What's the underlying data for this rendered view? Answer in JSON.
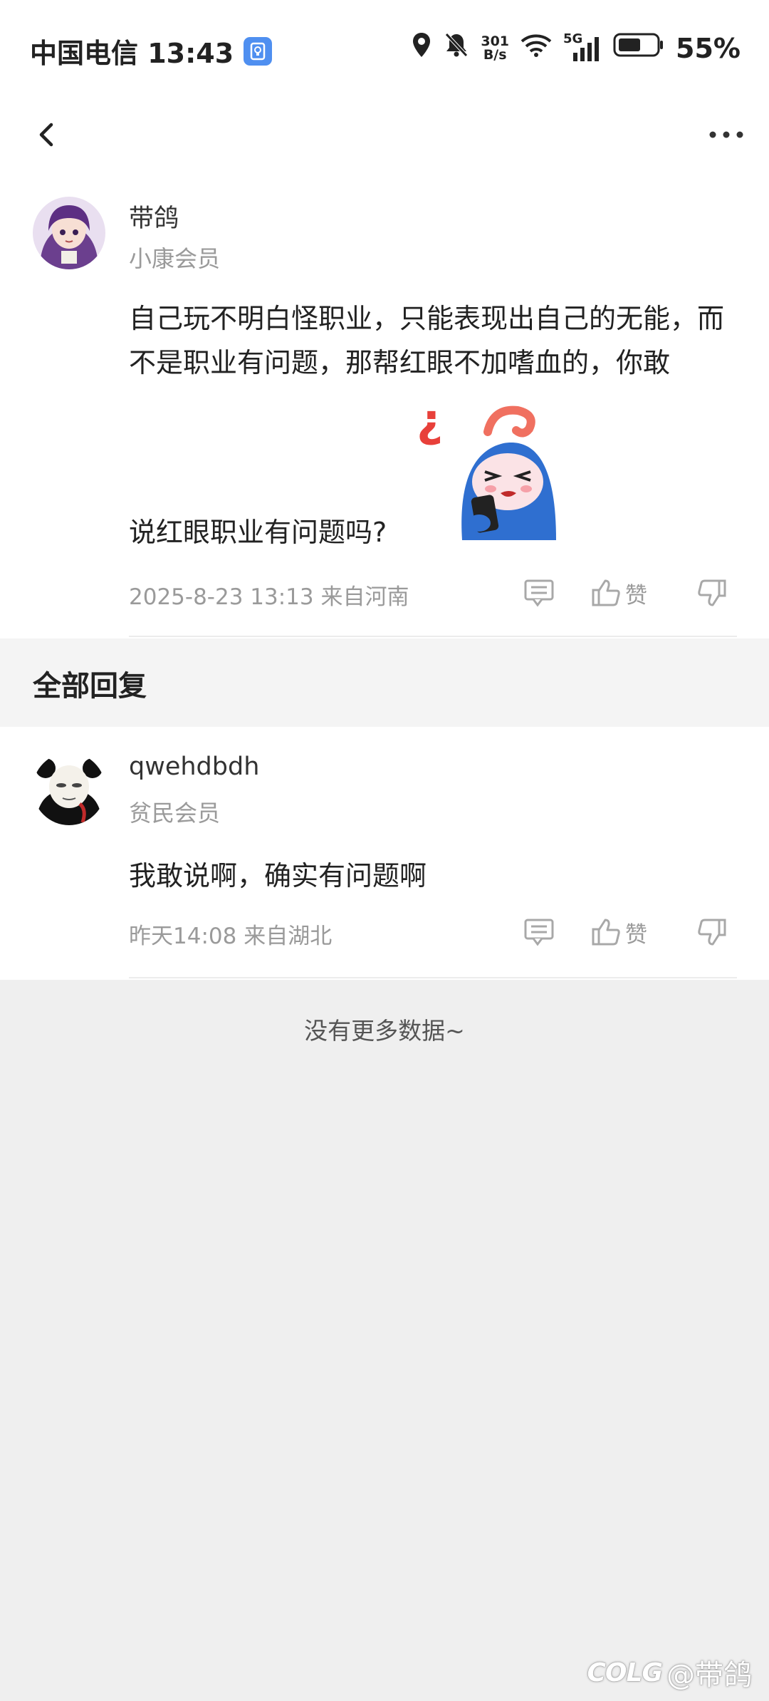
{
  "status_bar": {
    "carrier_time": "中国电信 13:43",
    "net_speed_top": "301",
    "net_speed_bottom": "B/s",
    "network": "5G",
    "battery": "55%"
  },
  "post": {
    "username": "带鸽",
    "level": "小康会员",
    "content": "自己玩不明白怪职业，只能表现出自己的无能，而不是职业有问题，那帮红眼不加嗜血的，你敢",
    "content_last": "说红眼职业有问题吗?",
    "time_location": "2025-8-23 13:13  来自河南",
    "like_label": "赞"
  },
  "section": {
    "title": "全部回复"
  },
  "reply": {
    "username": "qwehdbdh",
    "level": "贫民会员",
    "content": "我敢说啊，确实有问题啊",
    "time_location": "昨天14:08 来自湖北",
    "like_label": "赞"
  },
  "footer": {
    "no_more": "没有更多数据~"
  },
  "watermark": {
    "logo": "COLG",
    "handle": "@带鸽"
  },
  "icons": {
    "back": "chevron-left-icon",
    "more": "more-dots-icon",
    "comment": "comment-icon",
    "like": "thumbs-up-icon",
    "dislike": "thumbs-down-icon"
  }
}
